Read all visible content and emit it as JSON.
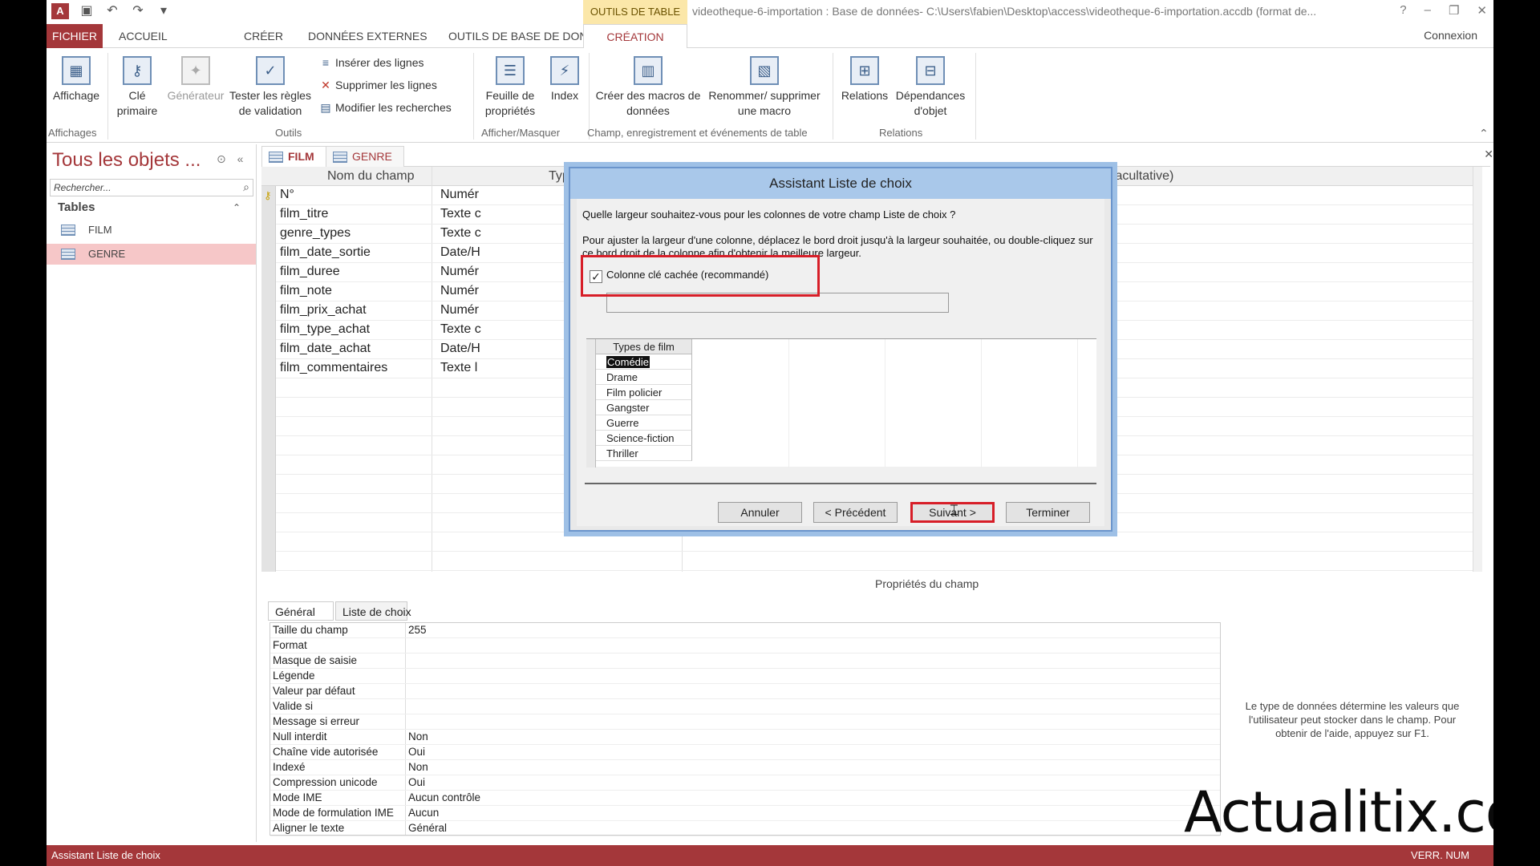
{
  "titlebar": {
    "app_logo": "A",
    "context_tools": "OUTILS DE TABLE",
    "doc_title": "videotheque-6-importation : Base de données- C:\\Users\\fabien\\Desktop\\access\\videotheque-6-importation.accdb (format de...",
    "help": "?"
  },
  "tabs": {
    "file": "FICHIER",
    "home": "ACCUEIL",
    "create": "CRÉER",
    "external": "DONNÉES EXTERNES",
    "dbtools": "OUTILS DE BASE DE DONNÉES",
    "design": "CRÉATION",
    "connexion": "Connexion"
  },
  "ribbon": {
    "view": "Affichage",
    "primary_key": "Clé primaire",
    "builder": "Générateur",
    "test_rules": "Tester les règles de validation",
    "insert_rows": "Insérer des lignes",
    "delete_rows": "Supprimer les lignes",
    "modify_lookups": "Modifier les recherches",
    "property_sheet": "Feuille de propriétés",
    "indexes": "Index",
    "create_macros": "Créer des macros de données",
    "rename_macro": "Renommer/ supprimer une macro",
    "relationships": "Relations",
    "dependencies": "Dépendances d'objet",
    "groups": {
      "views": "Affichages",
      "tools": "Outils",
      "show_hide": "Afficher/Masquer",
      "events": "Champ, enregistrement et événements de table",
      "relations": "Relations"
    }
  },
  "nav": {
    "title": "Tous les objets ...",
    "search_placeholder": "Rechercher...",
    "group": "Tables",
    "items": [
      "FILM",
      "GENRE"
    ]
  },
  "doctabs": [
    "FILM",
    "GENRE"
  ],
  "grid": {
    "col_field": "Nom du champ",
    "col_type": "Typ",
    "col_desc": "facultative)",
    "rows": [
      {
        "field": "N°",
        "type": "Numér"
      },
      {
        "field": "film_titre",
        "type": "Texte c"
      },
      {
        "field": "genre_types",
        "type": "Texte c"
      },
      {
        "field": "film_date_sortie",
        "type": "Date/H"
      },
      {
        "field": "film_duree",
        "type": "Numér"
      },
      {
        "field": "film_note",
        "type": "Numér"
      },
      {
        "field": "film_prix_achat",
        "type": "Numér"
      },
      {
        "field": "film_type_achat",
        "type": "Texte c"
      },
      {
        "field": "film_date_achat",
        "type": "Date/H"
      },
      {
        "field": "film_commentaires",
        "type": "Texte l"
      }
    ]
  },
  "props": {
    "title": "Propriétés du champ",
    "tab_general": "Général",
    "tab_lookup": "Liste de choix",
    "rows": [
      {
        "label": "Taille du champ",
        "value": "255"
      },
      {
        "label": "Format",
        "value": ""
      },
      {
        "label": "Masque de saisie",
        "value": ""
      },
      {
        "label": "Légende",
        "value": ""
      },
      {
        "label": "Valeur par défaut",
        "value": ""
      },
      {
        "label": "Valide si",
        "value": ""
      },
      {
        "label": "Message si erreur",
        "value": ""
      },
      {
        "label": "Null interdit",
        "value": "Non"
      },
      {
        "label": "Chaîne vide autorisée",
        "value": "Oui"
      },
      {
        "label": "Indexé",
        "value": "Non"
      },
      {
        "label": "Compression unicode",
        "value": "Oui"
      },
      {
        "label": "Mode IME",
        "value": "Aucun contrôle"
      },
      {
        "label": "Mode de formulation IME",
        "value": "Aucun"
      },
      {
        "label": "Aligner le texte",
        "value": "Général"
      }
    ],
    "help": "Le type de données détermine les valeurs que l'utilisateur peut stocker dans le champ. Pour obtenir de l'aide, appuyez sur F1."
  },
  "dialog": {
    "title": "Assistant Liste de choix",
    "question": "Quelle largeur souhaitez-vous pour les colonnes de votre champ Liste de choix ?",
    "description": "Pour ajuster la largeur d'une colonne, déplacez le bord droit jusqu'à la largeur souhaitée, ou double-cliquez sur ce bord droit de la colonne afin d'obtenir la meilleure largeur.",
    "checkbox_label": "Colonne clé cachée (recommandé)",
    "checkbox_mark": "✓",
    "column_header": "Types de film",
    "values": [
      "Comédie",
      "Drame",
      "Film policier",
      "Gangster",
      "Guerre",
      "Science-fiction",
      "Thriller"
    ],
    "btn_cancel": "Annuler",
    "btn_prev": "< Précédent",
    "btn_next": "Suivant >",
    "btn_finish": "Terminer"
  },
  "status": {
    "left": "Assistant Liste de choix",
    "right": "VERR. NUM"
  },
  "watermark": "Actualitix.com",
  "colors": {
    "accent": "#a4373a",
    "dialog_title": "#a9c8ea",
    "highlight_box": "#d71e28"
  }
}
